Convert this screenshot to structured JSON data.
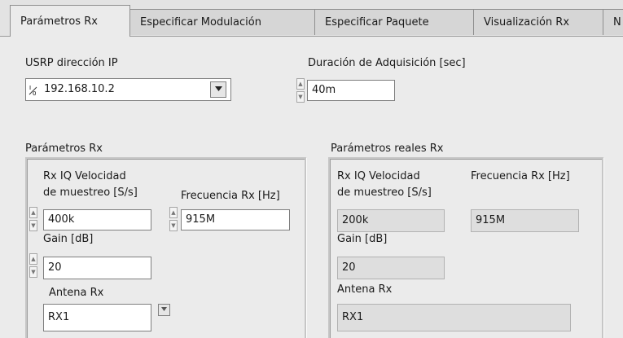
{
  "tabs": [
    {
      "label": "Parámetros Rx",
      "active": true
    },
    {
      "label": "Especificar Modulación",
      "active": false
    },
    {
      "label": "Especificar Paquete",
      "active": false
    },
    {
      "label": "Visualización Rx",
      "active": false
    },
    {
      "label": "N",
      "active": false
    }
  ],
  "usrp": {
    "label": "USRP dirección IP",
    "value": "192.168.10.2",
    "io_glyph": "I/O"
  },
  "duration": {
    "label": "Duración de Adquisición [sec]",
    "value": "40m"
  },
  "params_rx": {
    "title": "Parámetros Rx",
    "rate_label_1": "Rx IQ Velocidad",
    "rate_label_2": "de muestreo [S/s]",
    "rate_value": "400k",
    "freq_label": "Frecuencia Rx [Hz]",
    "freq_value": "915M",
    "gain_label": "Gain [dB]",
    "gain_value": "20",
    "antenna_label": "Antena Rx",
    "antenna_value": "RX1"
  },
  "params_real": {
    "title": "Parámetros reales Rx",
    "rate_label_1": "Rx IQ Velocidad",
    "rate_label_2": "de muestreo [S/s]",
    "rate_value": "200k",
    "freq_label": "Frecuencia Rx [Hz]",
    "freq_value": "915M",
    "gain_label": "Gain [dB]",
    "gain_value": "20",
    "antenna_label": "Antena Rx",
    "antenna_value": "RX1"
  },
  "colors": {
    "panel_bg": "#ebebeb",
    "indicator_bg": "#dedede",
    "control_bg": "#ffffff"
  }
}
